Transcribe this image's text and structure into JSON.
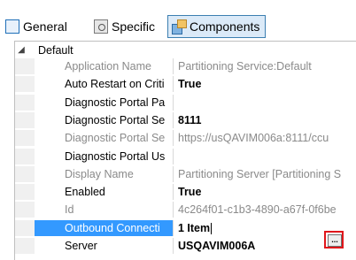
{
  "tabs": [
    {
      "label": "General",
      "icon": "general-icon"
    },
    {
      "label": "Specific",
      "icon": "specific-icon"
    },
    {
      "label": "Components",
      "icon": "components-icon",
      "active": true
    }
  ],
  "grid": {
    "category": {
      "label": "Default",
      "toggle_glyph": "◢"
    },
    "rows": [
      {
        "name": "Application Name",
        "value": "Partitioning Service:Default",
        "readonly": true,
        "bold": false
      },
      {
        "name": "Auto Restart on Criti",
        "value": "True",
        "readonly": false,
        "bold": true
      },
      {
        "name": "Diagnostic Portal Pa",
        "value": "",
        "readonly": false,
        "bold": false
      },
      {
        "name": "Diagnostic Portal Se",
        "value": "8111",
        "readonly": false,
        "bold": true
      },
      {
        "name": "Diagnostic Portal Se",
        "value": "https://usQAVIM006a:8111/ccu",
        "readonly": true,
        "bold": false
      },
      {
        "name": "Diagnostic Portal Us",
        "value": "",
        "readonly": false,
        "bold": false
      },
      {
        "name": "Display Name",
        "value": "Partitioning Server [Partitioning S",
        "readonly": true,
        "bold": false
      },
      {
        "name": "Enabled",
        "value": "True",
        "readonly": false,
        "bold": true
      },
      {
        "name": "Id",
        "value": "4c264f01-c1b3-4890-a67f-0f6be",
        "readonly": true,
        "bold": false
      },
      {
        "name": "Outbound Connecti",
        "value": "1 Item",
        "readonly": false,
        "bold": true,
        "selected": true
      },
      {
        "name": "Server",
        "value": "USQAVIM006A",
        "readonly": false,
        "bold": true
      }
    ],
    "ellipsis_label": "..."
  }
}
